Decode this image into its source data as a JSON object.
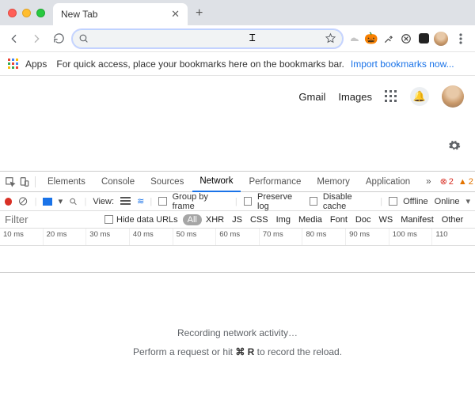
{
  "tab": {
    "title": "New Tab"
  },
  "omnibox": {
    "value": ""
  },
  "bookmarks": {
    "apps_label": "Apps",
    "hint": "For quick access, place your bookmarks here on the bookmarks bar.",
    "import": "Import bookmarks now..."
  },
  "ntp": {
    "gmail": "Gmail",
    "images": "Images"
  },
  "devtools": {
    "tabs": {
      "elements": "Elements",
      "console": "Console",
      "sources": "Sources",
      "network": "Network",
      "performance": "Performance",
      "memory": "Memory",
      "application": "Application"
    },
    "errors": "2",
    "warnings": "2",
    "bar": {
      "view": "View:",
      "group_by_frame": "Group by frame",
      "preserve_log": "Preserve log",
      "disable_cache": "Disable cache",
      "offline": "Offline",
      "online": "Online"
    },
    "filter": {
      "placeholder": "Filter",
      "hide_data_urls": "Hide data URLs",
      "types": [
        "All",
        "XHR",
        "JS",
        "CSS",
        "Img",
        "Media",
        "Font",
        "Doc",
        "WS",
        "Manifest",
        "Other"
      ]
    },
    "timeline": [
      "10 ms",
      "20 ms",
      "30 ms",
      "40 ms",
      "50 ms",
      "60 ms",
      "70 ms",
      "80 ms",
      "90 ms",
      "100 ms",
      "110"
    ],
    "stage": {
      "line1": "Recording network activity…",
      "line2_a": "Perform a request or hit ",
      "line2_key": "⌘ R",
      "line2_b": " to record the reload."
    }
  }
}
